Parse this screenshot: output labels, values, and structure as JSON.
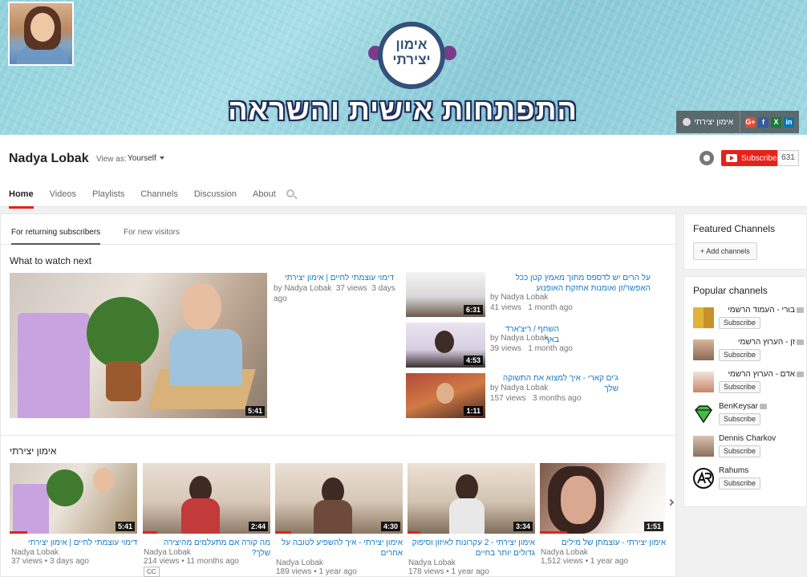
{
  "banner": {
    "logo_text": "אימון יצירתי",
    "title": "התפתחות אישית והשראה",
    "site_link": "אימון יצירתי",
    "social": [
      {
        "icon": "google-plus-icon",
        "label": "G+",
        "color": "#dd4b39"
      },
      {
        "icon": "facebook-icon",
        "label": "f",
        "color": "#3b5998"
      },
      {
        "icon": "xing-icon",
        "label": "X",
        "color": "#1a7a3c"
      },
      {
        "icon": "linkedin-icon",
        "label": "in",
        "color": "#0077b5"
      }
    ]
  },
  "channel": {
    "name": "Nadya Lobak",
    "view_as_label": "View as:",
    "view_as_value": "Yourself",
    "subscribe_label": "Subscribe",
    "subscriber_count": "631"
  },
  "tabs": [
    "Home",
    "Videos",
    "Playlists",
    "Channels",
    "Discussion",
    "About"
  ],
  "subtabs": [
    "For returning subscribers",
    "For new visitors"
  ],
  "what_to_watch": {
    "title": "What to watch next",
    "featured": {
      "title": "דימוי עוצמתי לחיים | אימון יצירתי",
      "author": "by Nadya Lobak",
      "views": "37 views",
      "age": "3 days ago",
      "duration": "5:41"
    },
    "side_videos": [
      {
        "title": "על הרים יש לדספס מתוך מאמץ קטן ככל האפשר/זן ואומנות אחזקת האופנוע",
        "author": "by Nadya Lobak",
        "views": "41 views",
        "age": "1 month ago",
        "duration": "6:31"
      },
      {
        "title": "השחף / ריצ'ארד באך",
        "author": "by Nadya Lobak",
        "views": "39 views",
        "age": "1 month ago",
        "duration": "4:53"
      },
      {
        "title": "ג'ים קארי - איך למצוא את התשוקה שלך",
        "author": "by Nadya Lobak",
        "views": "157 views",
        "age": "3 months ago",
        "duration": "1:11"
      }
    ]
  },
  "shelf": {
    "title": "אימון יצירתי",
    "videos": [
      {
        "title": "דימוי עוצמתי לחיים | אימון יצירתי",
        "author": "Nadya Lobak",
        "meta": "37 views • 3 days ago",
        "duration": "5:41",
        "cc": ""
      },
      {
        "title": "מה קורה אם מתעלמים מהיצירה שלך?",
        "author": "Nadya Lobak",
        "meta": "214 views • 11 months ago",
        "duration": "2:44",
        "cc": "CC"
      },
      {
        "title": "אימון יצירתי - איך להשפיע לטובה על אחרים",
        "author": "Nadya Lobak",
        "meta": "189 views • 1 year ago",
        "duration": "4:30",
        "cc": ""
      },
      {
        "title": "אימון יצירתי - 2 עקרונות לאיזון וסיפוק גדולים יותר בחיים",
        "author": "Nadya Lobak",
        "meta": "178 views • 1 year ago",
        "duration": "3:34",
        "cc": ""
      },
      {
        "title": "אימון יצירתי - עוצמתן של מילים",
        "author": "Nadya Lobak",
        "meta": "1,512 views • 1 year ago",
        "duration": "1:51",
        "cc": ""
      }
    ]
  },
  "sidebar": {
    "featured_title": "Featured Channels",
    "add_channels_label": "+ Add channels",
    "popular_title": "Popular channels",
    "popular": [
      {
        "name": "בורי - העמוד הרשמי",
        "subscribe": "Subscribe",
        "verified": true
      },
      {
        "name": "זן - הערוץ הרשמי",
        "subscribe": "Subscribe",
        "verified": true
      },
      {
        "name": "אדם - הערוץ הרשמי",
        "subscribe": "Subscribe",
        "verified": true
      },
      {
        "name": "BenKeysar",
        "subscribe": "Subscribe",
        "verified": true
      },
      {
        "name": "Dennis Charkov",
        "subscribe": "Subscribe",
        "verified": false
      },
      {
        "name": "Rahums",
        "subscribe": "Subscribe",
        "verified": false
      }
    ]
  }
}
